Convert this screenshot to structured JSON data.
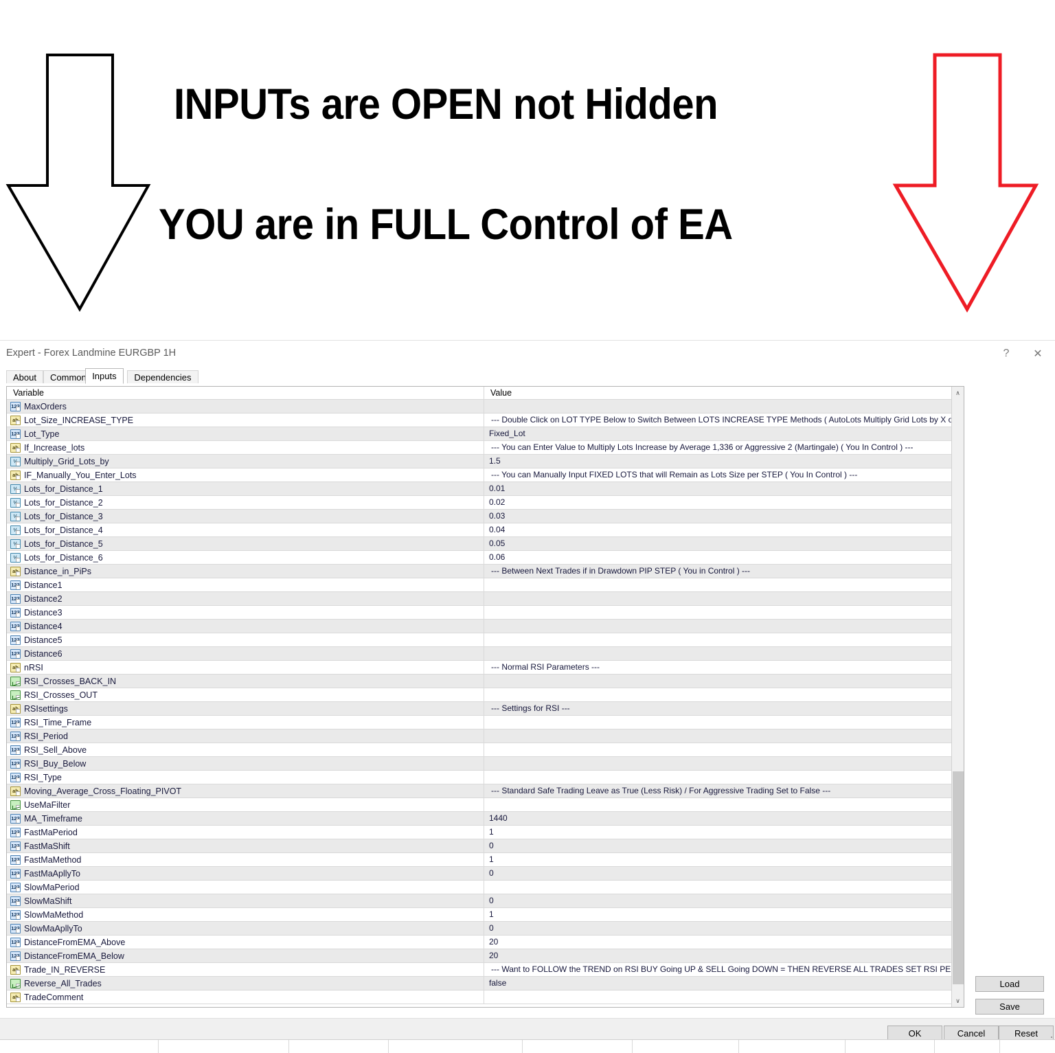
{
  "promo": {
    "line1": "INPUTs are OPEN not Hidden",
    "line2": "YOU are in FULL Control of EA",
    "left_arrow_color": "#000000",
    "right_arrow_color": "#ee1c25"
  },
  "window": {
    "title": "Expert - Forex Landmine EURGBP 1H",
    "help_glyph": "?",
    "close_glyph": "✕"
  },
  "tabs": [
    {
      "label": "About",
      "active": false
    },
    {
      "label": "Common",
      "active": false
    },
    {
      "label": "Inputs",
      "active": true
    },
    {
      "label": "Dependencies",
      "active": false
    }
  ],
  "grid": {
    "columns": [
      "Variable",
      "Value"
    ],
    "rows": [
      {
        "icon": "int",
        "variable": "MaxOrders",
        "value": ""
      },
      {
        "icon": "str",
        "variable": "Lot_Size_INCREASE_TYPE",
        "value": "--- Double Click on LOT TYPE Below to Switch Between LOTS INCREASE TYPE Methods ( AutoLots Multiply Grid Lots by X or You Decide L...",
        "comment": true
      },
      {
        "icon": "int",
        "variable": "Lot_Type",
        "value": "Fixed_Lot"
      },
      {
        "icon": "str",
        "variable": "If_Increase_lots",
        "value": "--- You can Enter Value to Multiply Lots Increase by Average 1,336 or Aggressive 2 (Martingale) ( You In Control ) ---",
        "comment": true
      },
      {
        "icon": "dbl",
        "variable": "Multiply_Grid_Lots_by",
        "value": "1.5"
      },
      {
        "icon": "str",
        "variable": "IF_Manually_You_Enter_Lots",
        "value": "--- You can Manually Input FIXED LOTS that will Remain as Lots Size per STEP ( You In Control ) ---",
        "comment": true
      },
      {
        "icon": "dbl",
        "variable": "Lots_for_Distance_1",
        "value": "0.01"
      },
      {
        "icon": "dbl",
        "variable": "Lots_for_Distance_2",
        "value": "0.02"
      },
      {
        "icon": "dbl",
        "variable": "Lots_for_Distance_3",
        "value": "0.03"
      },
      {
        "icon": "dbl",
        "variable": "Lots_for_Distance_4",
        "value": "0.04"
      },
      {
        "icon": "dbl",
        "variable": "Lots_for_Distance_5",
        "value": "0.05"
      },
      {
        "icon": "dbl",
        "variable": "Lots_for_Distance_6",
        "value": "0.06"
      },
      {
        "icon": "str",
        "variable": "Distance_in_PiPs",
        "value": "--- Between Next Trades if in Drawdown PIP STEP ( You in Control ) ---",
        "comment": true
      },
      {
        "icon": "int",
        "variable": "Distance1",
        "value": ""
      },
      {
        "icon": "int",
        "variable": "Distance2",
        "value": ""
      },
      {
        "icon": "int",
        "variable": "Distance3",
        "value": ""
      },
      {
        "icon": "int",
        "variable": "Distance4",
        "value": ""
      },
      {
        "icon": "int",
        "variable": "Distance5",
        "value": ""
      },
      {
        "icon": "int",
        "variable": "Distance6",
        "value": ""
      },
      {
        "icon": "str",
        "variable": "nRSI",
        "value": "--- Normal RSI Parameters ---",
        "comment": true
      },
      {
        "icon": "bool",
        "variable": "RSI_Crosses_BACK_IN",
        "value": ""
      },
      {
        "icon": "bool",
        "variable": "RSI_Crosses_OUT",
        "value": ""
      },
      {
        "icon": "str",
        "variable": "RSIsettings",
        "value": "--- Settings for RSI ---",
        "comment": true
      },
      {
        "icon": "int",
        "variable": "RSI_Time_Frame",
        "value": ""
      },
      {
        "icon": "int",
        "variable": "RSI_Period",
        "value": ""
      },
      {
        "icon": "int",
        "variable": "RSI_Sell_Above",
        "value": ""
      },
      {
        "icon": "int",
        "variable": "RSI_Buy_Below",
        "value": ""
      },
      {
        "icon": "int",
        "variable": "RSI_Type",
        "value": ""
      },
      {
        "icon": "str",
        "variable": "Moving_Average_Cross_Floating_PIVOT",
        "value": "--- Standard Safe Trading Leave as True (Less Risk) / For Aggressive Trading Set to False ---",
        "comment": true
      },
      {
        "icon": "bool",
        "variable": "UseMaFilter",
        "value": ""
      },
      {
        "icon": "int",
        "variable": "MA_Timeframe",
        "value": "1440"
      },
      {
        "icon": "int",
        "variable": "FastMaPeriod",
        "value": "1"
      },
      {
        "icon": "int",
        "variable": "FastMaShift",
        "value": "0"
      },
      {
        "icon": "int",
        "variable": "FastMaMethod",
        "value": "1"
      },
      {
        "icon": "int",
        "variable": "FastMaApllyTo",
        "value": "0"
      },
      {
        "icon": "int",
        "variable": "SlowMaPeriod",
        "value": ""
      },
      {
        "icon": "int",
        "variable": "SlowMaShift",
        "value": "0"
      },
      {
        "icon": "int",
        "variable": "SlowMaMethod",
        "value": "1"
      },
      {
        "icon": "int",
        "variable": "SlowMaApllyTo",
        "value": "0"
      },
      {
        "icon": "int",
        "variable": "DistanceFromEMA_Above",
        "value": "20"
      },
      {
        "icon": "int",
        "variable": "DistanceFromEMA_Below",
        "value": "20"
      },
      {
        "icon": "str",
        "variable": "Trade_IN_REVERSE",
        "value": "--- Want to FOLLOW the TREND on RSI BUY Going UP & SELL Going DOWN = THEN REVERSE ALL TRADES SET RSI PERIOD & Level...",
        "comment": true
      },
      {
        "icon": "bool",
        "variable": "Reverse_All_Trades",
        "value": "false"
      },
      {
        "icon": "str",
        "variable": "TradeComment",
        "value": ""
      }
    ]
  },
  "scrollbar": {
    "up_glyph": "∧",
    "down_glyph": "∨"
  },
  "side_buttons": {
    "load": "Load",
    "save": "Save"
  },
  "footer_buttons": {
    "ok": "OK",
    "cancel": "Cancel",
    "reset": "Reset"
  },
  "icon_names": {
    "int": "integer-type-icon",
    "str": "string-type-icon",
    "dbl": "double-type-icon",
    "bool": "boolean-type-icon"
  }
}
